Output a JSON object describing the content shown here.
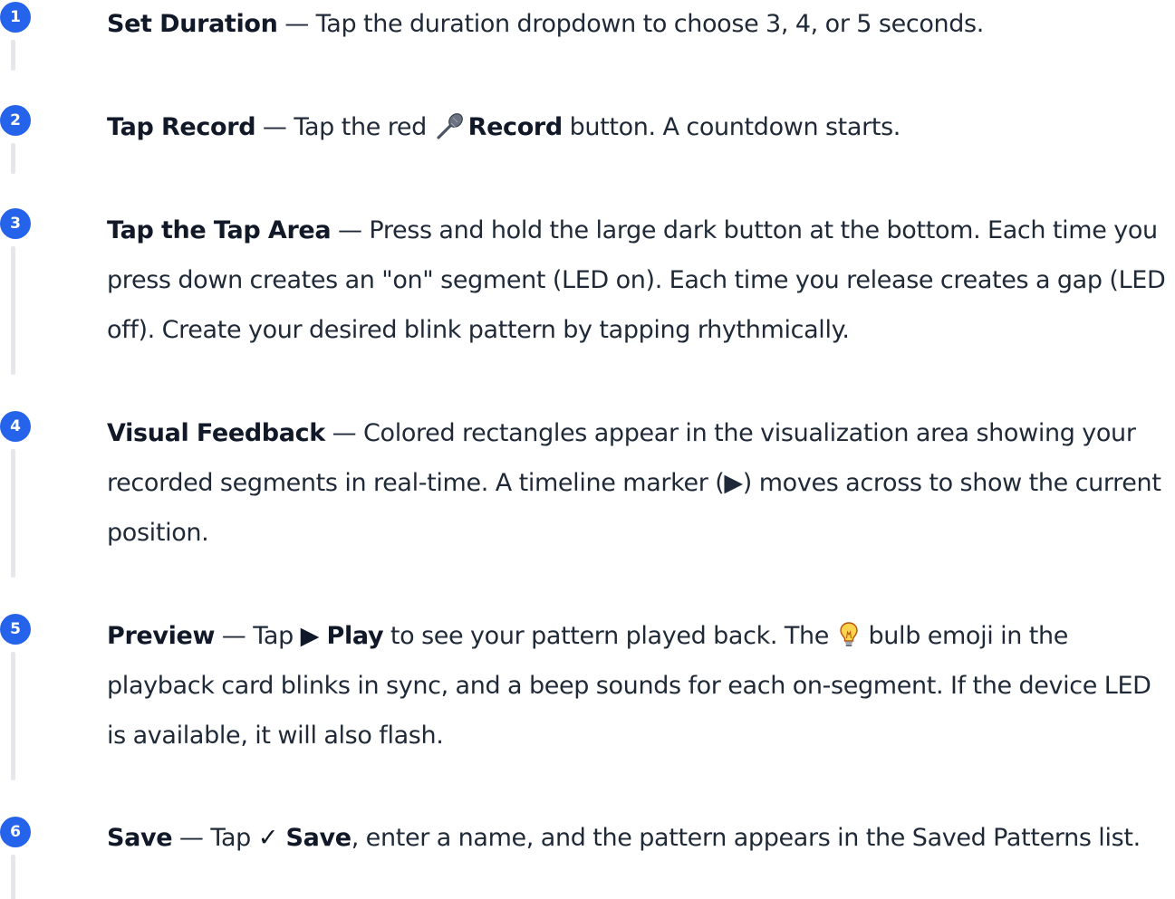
{
  "steps": [
    {
      "number": "1",
      "title": "Set Duration",
      "sep": " — ",
      "text": "Tap the duration dropdown to choose 3, 4, or 5 seconds."
    },
    {
      "number": "2",
      "title": "Tap Record",
      "sep": " — ",
      "text_a": "Tap the red ",
      "bold_a": "Record",
      "text_b": " button. A countdown starts."
    },
    {
      "number": "3",
      "title": "Tap the Tap Area",
      "sep": " — ",
      "text": "Press and hold the large dark button at the bottom. Each time you press down creates an \"on\" segment (LED on). Each time you release creates a gap (LED off). Create your desired blink pattern by tapping rhythmically."
    },
    {
      "number": "4",
      "title": "Visual Feedback",
      "sep": " — ",
      "text": "Colored rectangles appear in the visualization area showing your recorded segments in real-time. A timeline marker (▶) moves across to show the current position."
    },
    {
      "number": "5",
      "title": "Preview",
      "sep": " — ",
      "text_a": "Tap ",
      "bold_a": "▶ Play",
      "text_b": " to see your pattern played back. The ",
      "text_c": " bulb emoji in the playback card blinks in sync, and a beep sounds for each on-segment. If the device LED is available, it will also flash."
    },
    {
      "number": "6",
      "title": "Save",
      "sep": " — ",
      "text_a": "Tap ",
      "bold_a": "✓ Save",
      "text_b": ", enter a name, and the pattern appears in the Saved Patterns list."
    }
  ],
  "colors": {
    "badge": "#2563eb",
    "rail": "#e5e7eb",
    "text": "#1f2937"
  },
  "icons": {
    "record": "microphone-icon",
    "bulb": "light-bulb-icon"
  }
}
